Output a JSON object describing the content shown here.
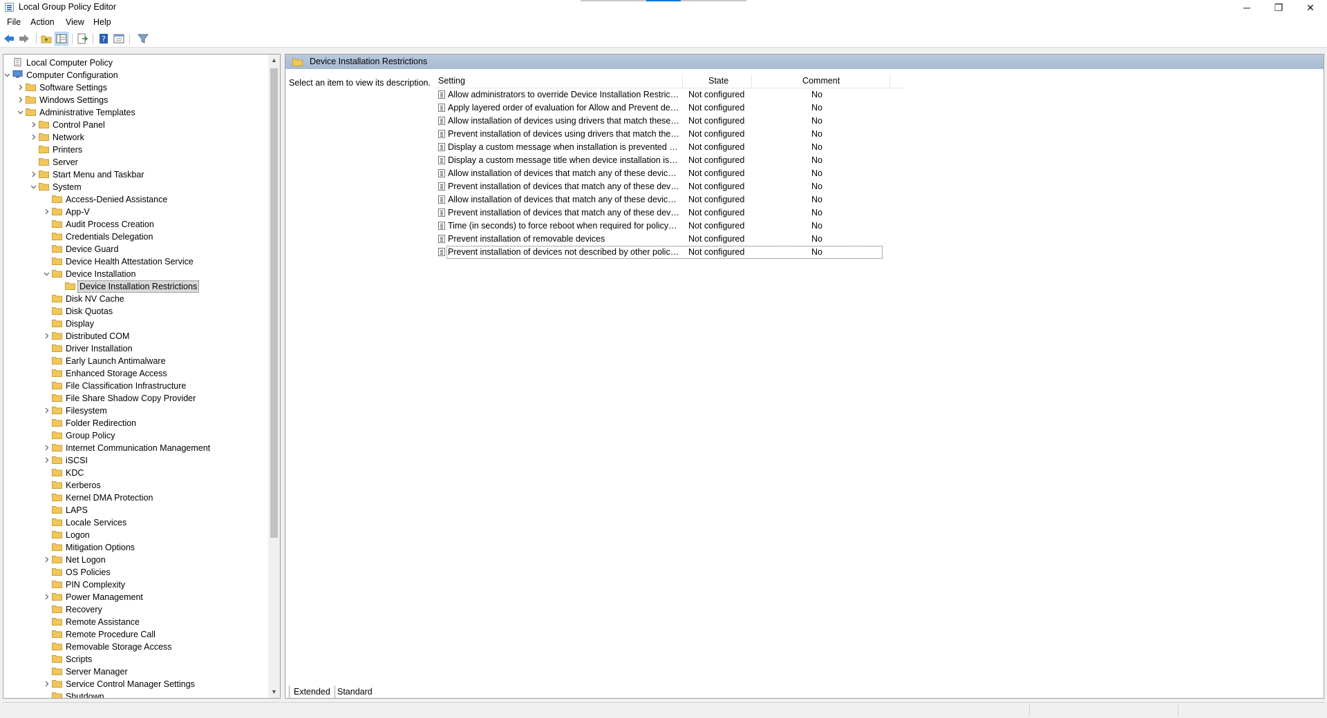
{
  "window": {
    "title": "Local Group Policy Editor",
    "minimize_glyph": "─",
    "restore_glyph": "❐",
    "close_glyph": "✕"
  },
  "menu": [
    "File",
    "Action",
    "View",
    "Help"
  ],
  "toolbar": {
    "buttons": [
      "back-icon",
      "forward-icon",
      "up-folder-icon",
      "show-hide-tree-icon",
      "export-list-icon",
      "help-icon",
      "properties-icon",
      "filter-icon"
    ]
  },
  "tree": {
    "items": [
      {
        "label": "Local Computer Policy",
        "level": 0,
        "toggle": "none"
      },
      {
        "label": "Computer Configuration",
        "level": 0,
        "toggle": "expanded"
      },
      {
        "label": "Software Settings",
        "level": 1,
        "toggle": "collapsed"
      },
      {
        "label": "Windows Settings",
        "level": 1,
        "toggle": "collapsed"
      },
      {
        "label": "Administrative Templates",
        "level": 1,
        "toggle": "expanded"
      },
      {
        "label": "Control Panel",
        "level": 2,
        "toggle": "collapsed"
      },
      {
        "label": "Network",
        "level": 2,
        "toggle": "collapsed"
      },
      {
        "label": "Printers",
        "level": 2,
        "toggle": "none"
      },
      {
        "label": "Server",
        "level": 2,
        "toggle": "none"
      },
      {
        "label": "Start Menu and Taskbar",
        "level": 2,
        "toggle": "collapsed"
      },
      {
        "label": "System",
        "level": 2,
        "toggle": "expanded"
      },
      {
        "label": "Access-Denied Assistance",
        "level": 3,
        "toggle": "none"
      },
      {
        "label": "App-V",
        "level": 3,
        "toggle": "collapsed"
      },
      {
        "label": "Audit Process Creation",
        "level": 3,
        "toggle": "none"
      },
      {
        "label": "Credentials Delegation",
        "level": 3,
        "toggle": "none"
      },
      {
        "label": "Device Guard",
        "level": 3,
        "toggle": "none"
      },
      {
        "label": "Device Health Attestation Service",
        "level": 3,
        "toggle": "none"
      },
      {
        "label": "Device Installation",
        "level": 3,
        "toggle": "expanded"
      },
      {
        "label": "Device Installation Restrictions",
        "level": 4,
        "toggle": "none",
        "selected": true
      },
      {
        "label": "Disk NV Cache",
        "level": 3,
        "toggle": "none"
      },
      {
        "label": "Disk Quotas",
        "level": 3,
        "toggle": "none"
      },
      {
        "label": "Display",
        "level": 3,
        "toggle": "none"
      },
      {
        "label": "Distributed COM",
        "level": 3,
        "toggle": "collapsed"
      },
      {
        "label": "Driver Installation",
        "level": 3,
        "toggle": "none"
      },
      {
        "label": "Early Launch Antimalware",
        "level": 3,
        "toggle": "none"
      },
      {
        "label": "Enhanced Storage Access",
        "level": 3,
        "toggle": "none"
      },
      {
        "label": "File Classification Infrastructure",
        "level": 3,
        "toggle": "none"
      },
      {
        "label": "File Share Shadow Copy Provider",
        "level": 3,
        "toggle": "none"
      },
      {
        "label": "Filesystem",
        "level": 3,
        "toggle": "collapsed"
      },
      {
        "label": "Folder Redirection",
        "level": 3,
        "toggle": "none"
      },
      {
        "label": "Group Policy",
        "level": 3,
        "toggle": "none"
      },
      {
        "label": "Internet Communication Management",
        "level": 3,
        "toggle": "collapsed"
      },
      {
        "label": "iSCSI",
        "level": 3,
        "toggle": "collapsed"
      },
      {
        "label": "KDC",
        "level": 3,
        "toggle": "none"
      },
      {
        "label": "Kerberos",
        "level": 3,
        "toggle": "none"
      },
      {
        "label": "Kernel DMA Protection",
        "level": 3,
        "toggle": "none"
      },
      {
        "label": "LAPS",
        "level": 3,
        "toggle": "none"
      },
      {
        "label": "Locale Services",
        "level": 3,
        "toggle": "none"
      },
      {
        "label": "Logon",
        "level": 3,
        "toggle": "none"
      },
      {
        "label": "Mitigation Options",
        "level": 3,
        "toggle": "none"
      },
      {
        "label": "Net Logon",
        "level": 3,
        "toggle": "collapsed"
      },
      {
        "label": "OS Policies",
        "level": 3,
        "toggle": "none"
      },
      {
        "label": "PIN Complexity",
        "level": 3,
        "toggle": "none"
      },
      {
        "label": "Power Management",
        "level": 3,
        "toggle": "collapsed"
      },
      {
        "label": "Recovery",
        "level": 3,
        "toggle": "none"
      },
      {
        "label": "Remote Assistance",
        "level": 3,
        "toggle": "none"
      },
      {
        "label": "Remote Procedure Call",
        "level": 3,
        "toggle": "none"
      },
      {
        "label": "Removable Storage Access",
        "level": 3,
        "toggle": "none"
      },
      {
        "label": "Scripts",
        "level": 3,
        "toggle": "none"
      },
      {
        "label": "Server Manager",
        "level": 3,
        "toggle": "none"
      },
      {
        "label": "Service Control Manager Settings",
        "level": 3,
        "toggle": "collapsed"
      },
      {
        "label": "Shutdown",
        "level": 3,
        "toggle": "none"
      }
    ]
  },
  "details": {
    "header": "Device Installation Restrictions",
    "description": "Select an item to view its description.",
    "columns": {
      "setting": "Setting",
      "state": "State",
      "comment": "Comment"
    },
    "rows": [
      {
        "setting": "Allow administrators to override Device Installation Restrictio...",
        "state": "Not configured",
        "comment": "No"
      },
      {
        "setting": "Apply layered order of evaluation for Allow and Prevent devi...",
        "state": "Not configured",
        "comment": "No"
      },
      {
        "setting": "Allow installation of devices using drivers that match these ...",
        "state": "Not configured",
        "comment": "No"
      },
      {
        "setting": "Prevent installation of devices using drivers that match thes...",
        "state": "Not configured",
        "comment": "No"
      },
      {
        "setting": "Display a custom message when installation is prevented by...",
        "state": "Not configured",
        "comment": "No"
      },
      {
        "setting": "Display a custom message title when device installation is pr...",
        "state": "Not configured",
        "comment": "No"
      },
      {
        "setting": "Allow installation of devices that match any of these device ...",
        "state": "Not configured",
        "comment": "No"
      },
      {
        "setting": "Prevent installation of devices that match any of these devic...",
        "state": "Not configured",
        "comment": "No"
      },
      {
        "setting": "Allow installation of devices that match any of these device ...",
        "state": "Not configured",
        "comment": "No"
      },
      {
        "setting": "Prevent installation of devices that match any of these devic...",
        "state": "Not configured",
        "comment": "No"
      },
      {
        "setting": "Time (in seconds) to force reboot when required for policy c...",
        "state": "Not configured",
        "comment": "No"
      },
      {
        "setting": "Prevent installation of removable devices",
        "state": "Not configured",
        "comment": "No"
      },
      {
        "setting": "Prevent installation of devices not described by other policy ...",
        "state": "Not configured",
        "comment": "No",
        "focused": true
      }
    ]
  },
  "tabs": [
    "Extended",
    "Standard"
  ],
  "colors": {
    "header_blue": "#b8c9dc",
    "folder_yellow": "#f1c65a",
    "selection_gray": "#d9d9d9",
    "accent_blue": "#0078d7"
  }
}
